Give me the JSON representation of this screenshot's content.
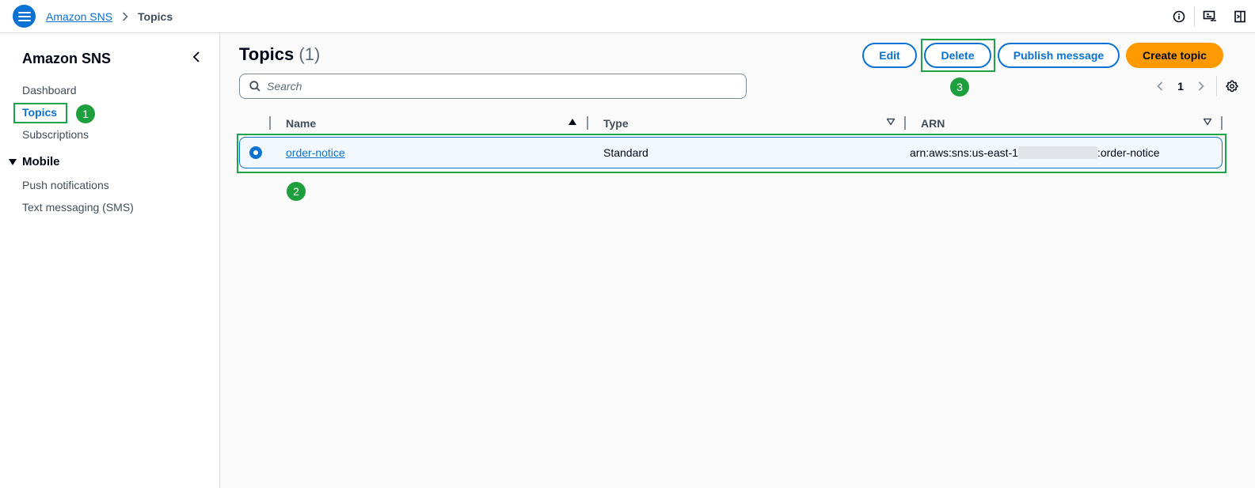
{
  "header": {
    "service_link": "Amazon SNS",
    "current_page": "Topics"
  },
  "sidebar": {
    "title": "Amazon SNS",
    "items": [
      {
        "label": "Dashboard"
      },
      {
        "label": "Topics",
        "active": true
      },
      {
        "label": "Subscriptions"
      }
    ],
    "section": {
      "label": "Mobile",
      "items": [
        {
          "label": "Push notifications"
        },
        {
          "label": "Text messaging (SMS)"
        }
      ]
    }
  },
  "main": {
    "title": "Topics",
    "count": "(1)",
    "actions": {
      "edit": "Edit",
      "delete": "Delete",
      "publish": "Publish message",
      "create": "Create topic"
    },
    "search": {
      "placeholder": "Search",
      "value": ""
    },
    "pagination": {
      "current_page": "1"
    },
    "table": {
      "columns": [
        "Name",
        "Type",
        "ARN"
      ],
      "rows": [
        {
          "name": "order-notice",
          "type": "Standard",
          "arn_prefix": "arn:aws:sns:us-east-1",
          "arn_suffix": ":order-notice",
          "selected": true
        }
      ]
    }
  },
  "annotations": {
    "step1": "1",
    "step2": "2",
    "step3": "3"
  },
  "colors": {
    "accent": "#0972d3",
    "primary_button": "#ff9900",
    "annotation": "#1e9f3d"
  }
}
